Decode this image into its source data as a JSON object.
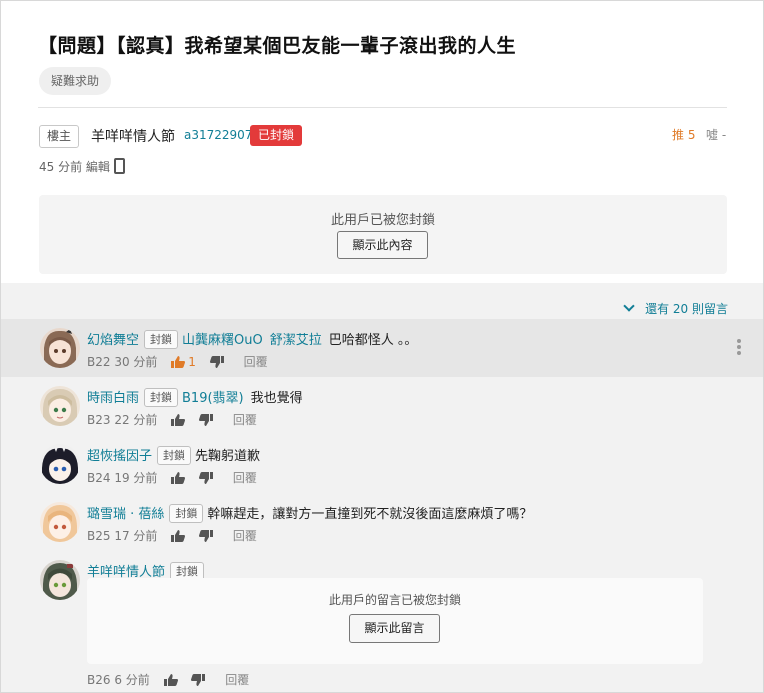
{
  "post": {
    "title": "【問題】【認真】我希望某個巴友能一輩子滾出我的人生",
    "tag": "疑難求助",
    "op_badge": "樓主",
    "author_name": "羊咩咩情人節",
    "author_id": "a31722907",
    "blocked_badge": "已封鎖",
    "push": "推 5",
    "boo": "噓 -",
    "edited_meta": "45 分前 編輯",
    "blocked_message": "此用戶已被您封鎖",
    "show_content_button": "顯示此內容"
  },
  "comments_section": {
    "more_replies": "還有 20 則留言",
    "comments": [
      {
        "user": "幻焰舞空",
        "block_label": "封鎖",
        "mentions": [
          "山龔麻糬OuO",
          "舒潔艾拉"
        ],
        "text": "巴哈都怪人 。。",
        "floor": "B22",
        "time": "30 分前",
        "likes": "1",
        "reply": "回覆",
        "highlighted": true
      },
      {
        "user": "時雨白雨",
        "block_label": "封鎖",
        "mentions": [
          "B19(翡翠)"
        ],
        "text": "我也覺得",
        "floor": "B23",
        "time": "22 分前",
        "likes": "",
        "reply": "回覆"
      },
      {
        "user": "超恢搖因子",
        "block_label": "封鎖",
        "mentions": [],
        "text": "先鞠躬道歉",
        "floor": "B24",
        "time": "19 分前",
        "likes": "",
        "reply": "回覆"
      },
      {
        "user": "璐雪瑞 · 蓓絲",
        "block_label": "封鎖",
        "mentions": [],
        "text": "幹嘛趕走，讓對方一直撞到死不就沒後面這麼麻煩了嗎？",
        "floor": "B25",
        "time": "17 分前",
        "likes": "",
        "reply": "回覆"
      }
    ],
    "blocked_comment": {
      "user": "羊咩咩情人節",
      "block_label": "封鎖",
      "message": "此用戶的留言已被您封鎖",
      "button": "顯示此留言",
      "floor": "B26",
      "time": "6 分前",
      "reply": "回覆"
    }
  },
  "colors": {
    "link": "#117e96",
    "push": "#e07b28",
    "blocked_badge": "#e33a3a"
  }
}
